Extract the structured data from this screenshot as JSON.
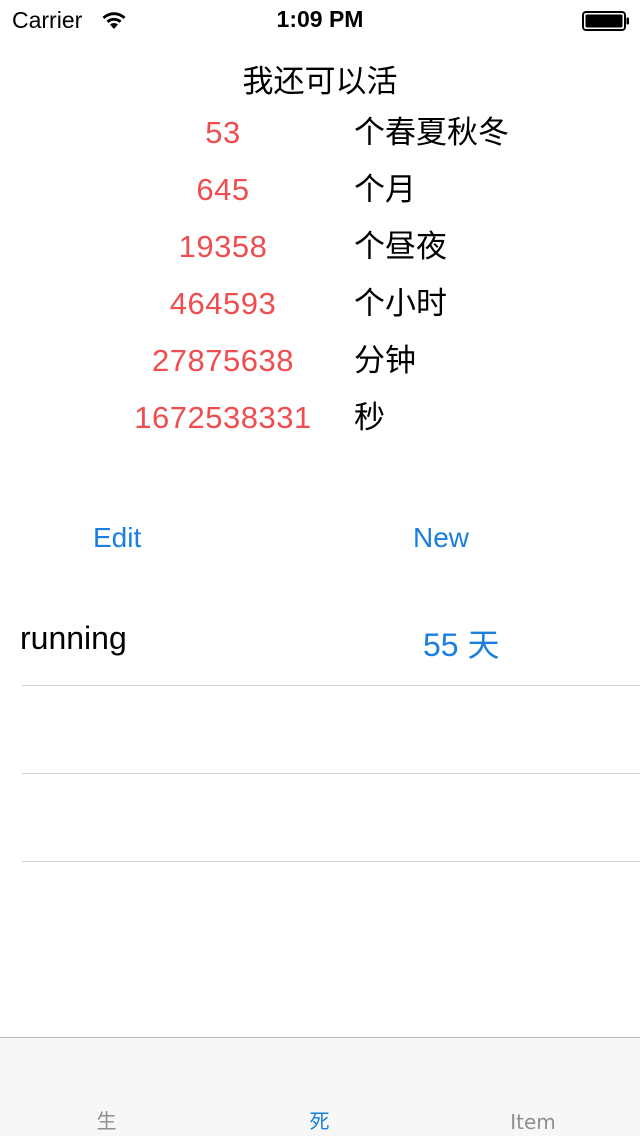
{
  "status_bar": {
    "carrier": "Carrier",
    "time": "1:09 PM",
    "wifi_icon": "wifi-icon",
    "battery_icon": "battery-icon"
  },
  "title": "我还可以活",
  "stats": [
    {
      "value": "53",
      "unit": "个春夏秋冬"
    },
    {
      "value": "645",
      "unit": "个月"
    },
    {
      "value": "19358",
      "unit": "个昼夜"
    },
    {
      "value": "464593",
      "unit": "个小时"
    },
    {
      "value": "27875638",
      "unit": "分钟"
    },
    {
      "value": "1672538331",
      "unit": "秒"
    }
  ],
  "buttons": {
    "edit": "Edit",
    "new": "New"
  },
  "list": [
    {
      "name": "running",
      "days": "55 天"
    },
    {
      "name": "",
      "days": ""
    },
    {
      "name": "",
      "days": ""
    },
    {
      "name": "",
      "days": ""
    }
  ],
  "tabs": [
    {
      "label": "生",
      "active": false
    },
    {
      "label": "死",
      "active": true
    },
    {
      "label": "Item",
      "active": false
    }
  ],
  "colors": {
    "accent": "#1a7fe0",
    "stat_value": "#ef4d4f",
    "tab_inactive": "#8e8e93"
  }
}
